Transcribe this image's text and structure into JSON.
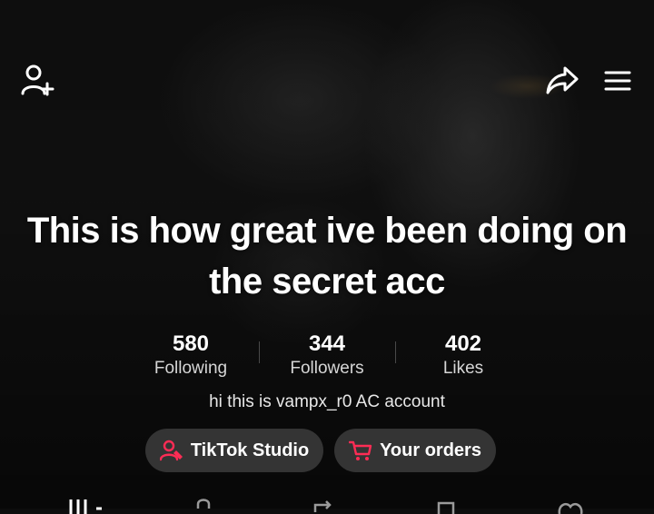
{
  "header": {
    "add_friend_icon": "add-user-icon",
    "share_icon": "share-arrow-icon",
    "menu_icon": "hamburger-menu-icon"
  },
  "profile": {
    "bio_title": "This is how great ive been doing on the secret acc",
    "bio_text": "hi this is vampx_r0 AC account"
  },
  "stats": {
    "following": {
      "value": "580",
      "label": "Following"
    },
    "followers": {
      "value": "344",
      "label": "Followers"
    },
    "likes": {
      "value": "402",
      "label": "Likes"
    }
  },
  "actions": {
    "studio_label": "TikTok Studio",
    "orders_label": "Your orders",
    "accent_color": "#fe2c55"
  },
  "tabs": [
    "videos-grid-icon",
    "lock-icon",
    "repost-icon",
    "saved-icon",
    "liked-icon"
  ]
}
